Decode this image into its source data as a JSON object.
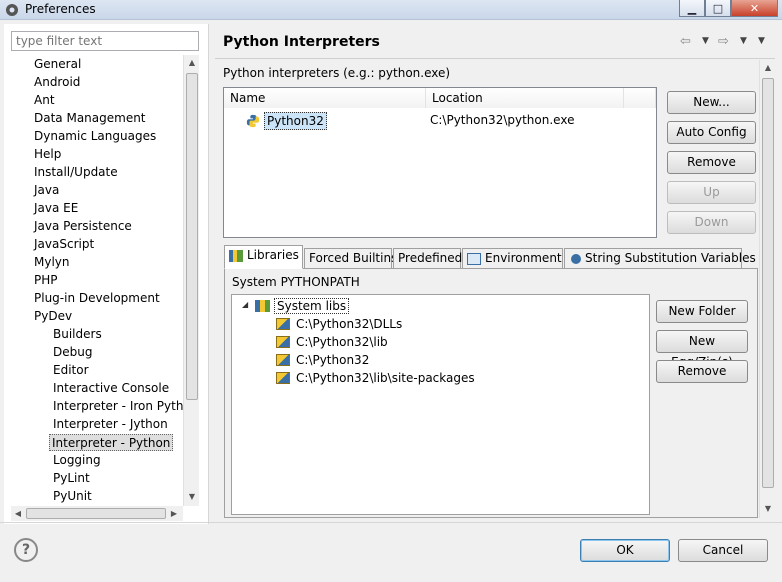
{
  "window": {
    "title": "Preferences"
  },
  "filter": {
    "placeholder": "type filter text"
  },
  "tree": {
    "items": [
      {
        "label": "General",
        "level": 0
      },
      {
        "label": "Android",
        "level": 0
      },
      {
        "label": "Ant",
        "level": 0
      },
      {
        "label": "Data Management",
        "level": 0
      },
      {
        "label": "Dynamic Languages",
        "level": 0
      },
      {
        "label": "Help",
        "level": 0
      },
      {
        "label": "Install/Update",
        "level": 0
      },
      {
        "label": "Java",
        "level": 0
      },
      {
        "label": "Java EE",
        "level": 0
      },
      {
        "label": "Java Persistence",
        "level": 0
      },
      {
        "label": "JavaScript",
        "level": 0
      },
      {
        "label": "Mylyn",
        "level": 0
      },
      {
        "label": "PHP",
        "level": 0
      },
      {
        "label": "Plug-in Development",
        "level": 0
      },
      {
        "label": "PyDev",
        "level": 0
      },
      {
        "label": "Builders",
        "level": 1
      },
      {
        "label": "Debug",
        "level": 1
      },
      {
        "label": "Editor",
        "level": 1
      },
      {
        "label": "Interactive Console",
        "level": 1
      },
      {
        "label": "Interpreter - Iron Python",
        "level": 1
      },
      {
        "label": "Interpreter - Jython",
        "level": 1
      },
      {
        "label": "Interpreter - Python",
        "level": 1,
        "selected": true
      },
      {
        "label": "Logging",
        "level": 1
      },
      {
        "label": "PyLint",
        "level": 1
      },
      {
        "label": "PyUnit",
        "level": 1
      }
    ]
  },
  "page": {
    "title": "Python Interpreters",
    "subtitle": "Python interpreters (e.g.: python.exe)",
    "columns": [
      "Name",
      "Location"
    ],
    "interpreters": [
      {
        "name": "Python32",
        "location": "C:\\Python32\\python.exe"
      }
    ],
    "buttons": {
      "new": "New...",
      "auto_config": "Auto Config",
      "remove": "Remove",
      "up": "Up",
      "down": "Down"
    }
  },
  "tabs": [
    {
      "label": "Libraries",
      "icon": "libraries-icon",
      "active": true
    },
    {
      "label": "Forced Builtins"
    },
    {
      "label": "Predefined"
    },
    {
      "label": "Environment",
      "icon": "environment-icon"
    },
    {
      "label": "String Substitution Variables",
      "icon": "variables-icon"
    }
  ],
  "libraries": {
    "heading": "System PYTHONPATH",
    "root": "System libs",
    "paths": [
      "C:\\Python32\\DLLs",
      "C:\\Python32\\lib",
      "C:\\Python32",
      "C:\\Python32\\lib\\site-packages"
    ],
    "buttons": {
      "new_folder": "New Folder",
      "new_egg": "New Egg/Zip(s)",
      "remove": "Remove"
    }
  },
  "footer": {
    "ok": "OK",
    "cancel": "Cancel"
  },
  "colors": {
    "selection": "#cce4f7",
    "title_bar": "#c9d7ea"
  }
}
